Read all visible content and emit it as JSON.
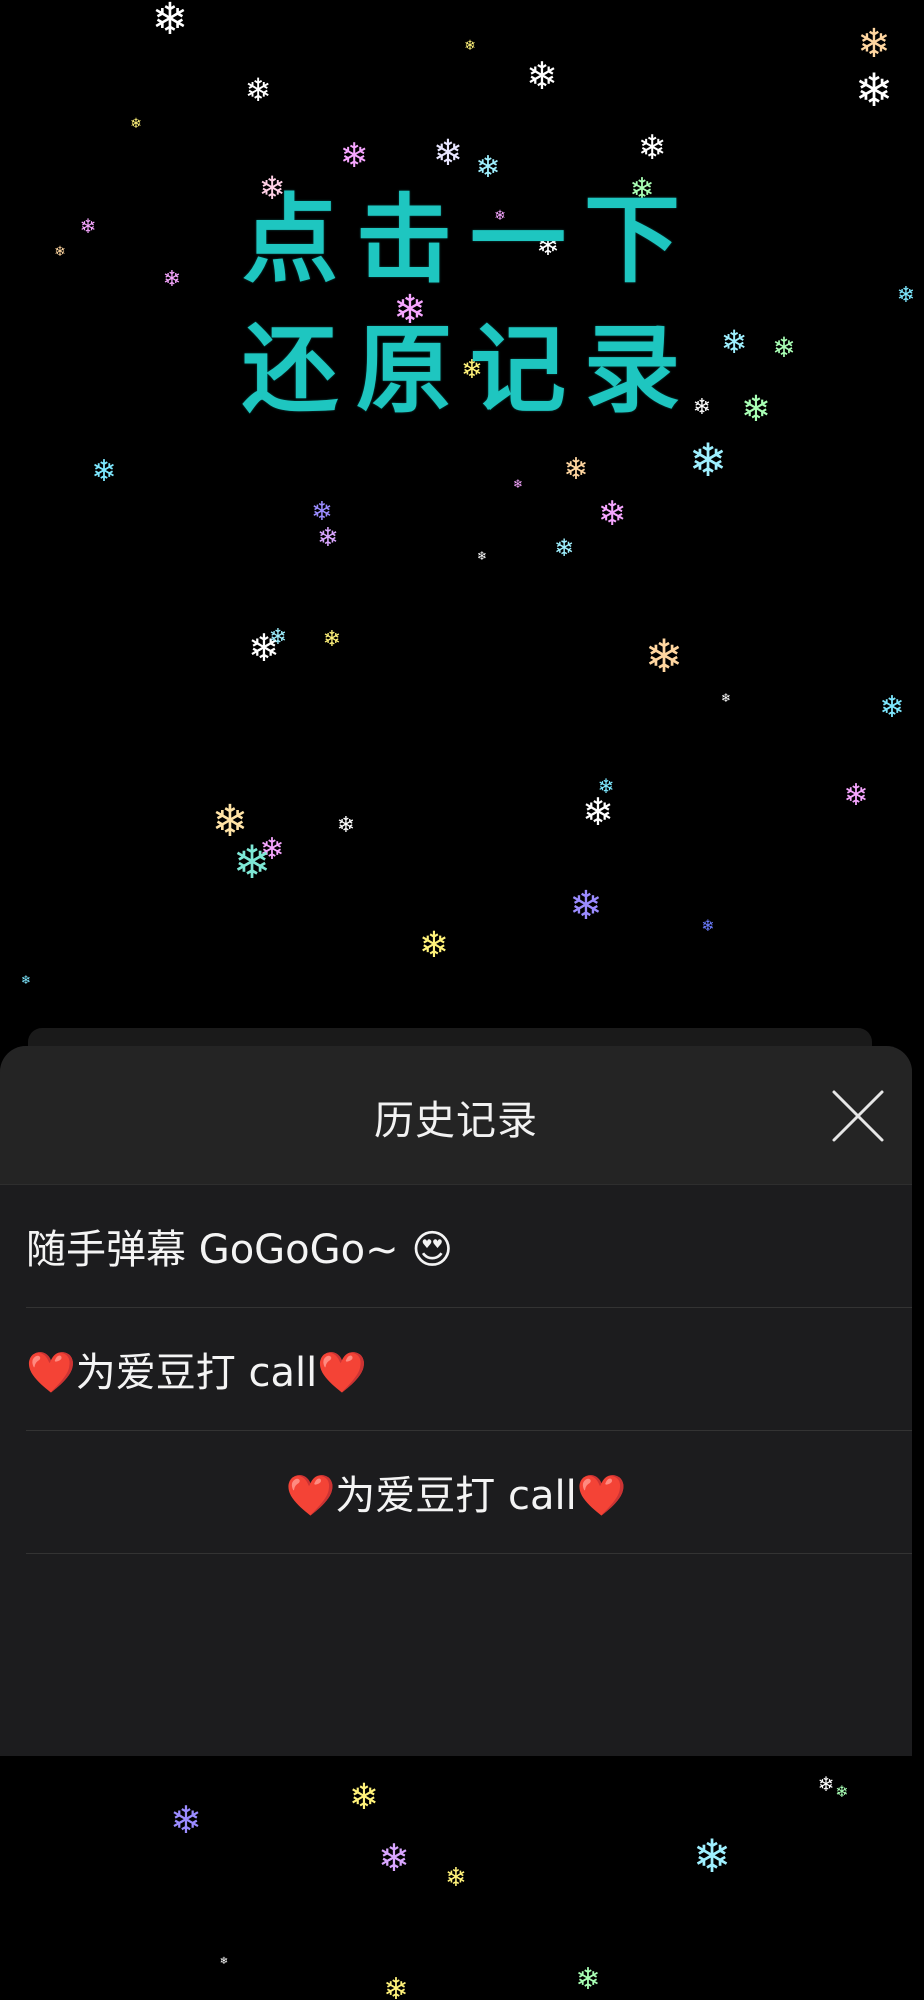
{
  "background": {
    "color": "#000000"
  },
  "hero": {
    "line1": "点击一下",
    "line2": "还原记录",
    "color": "#1ec6c0"
  },
  "history_sheet": {
    "title": "历史记录",
    "close_icon": "close-icon",
    "items": [
      {
        "label": "随手弹幕 GoGoGo~ 😍",
        "align": "left"
      },
      {
        "label": "❤️为爱豆打 call❤️",
        "align": "left"
      },
      {
        "label": "❤️为爱豆打 call❤️",
        "align": "center"
      }
    ]
  },
  "decorations": {
    "icon": "snowflake-icon",
    "colors": [
      "#ffffff",
      "#f6a6ff",
      "#9ff0ff",
      "#fff27a",
      "#a9ffb5",
      "#ffd6a0",
      "#9b8cff",
      "#7ee8ff"
    ]
  }
}
